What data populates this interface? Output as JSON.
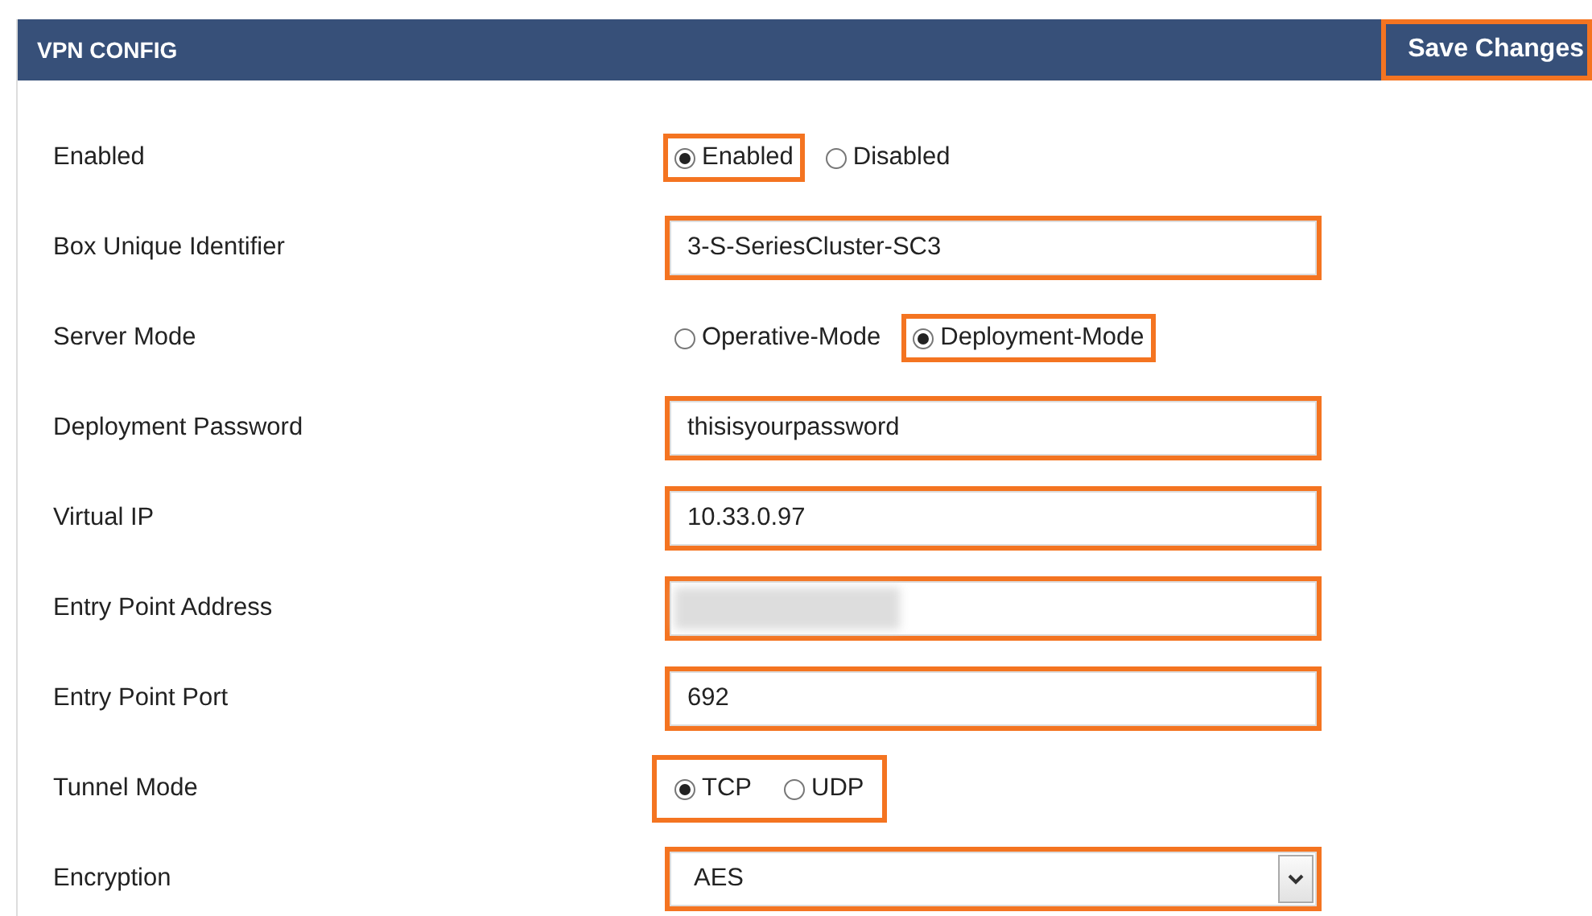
{
  "panel": {
    "title": "VPN CONFIG",
    "save_button": {
      "label": "Save Changes",
      "highlighted": true
    }
  },
  "rows": [
    {
      "label": "Enabled",
      "kind": "radio",
      "highlighted": false,
      "options": [
        {
          "label": "Enabled",
          "selected": true,
          "highlighted": true
        },
        {
          "label": "Disabled",
          "selected": false,
          "highlighted": false
        }
      ]
    },
    {
      "label": "Box Unique Identifier",
      "kind": "text",
      "value": "3-S-SeriesCluster-SC3",
      "highlighted": true
    },
    {
      "label": "Server Mode",
      "kind": "radio",
      "highlighted": false,
      "options": [
        {
          "label": "Operative-Mode",
          "selected": false,
          "highlighted": false
        },
        {
          "label": "Deployment-Mode",
          "selected": true,
          "highlighted": true
        }
      ]
    },
    {
      "label": "Deployment Password",
      "kind": "text",
      "value": "thisisyourpassword",
      "highlighted": true
    },
    {
      "label": "Virtual IP",
      "kind": "text",
      "value": "10.33.0.97",
      "highlighted": true
    },
    {
      "label": "Entry Point Address",
      "kind": "text",
      "redacted": true,
      "highlighted": true
    },
    {
      "label": "Entry Point Port",
      "kind": "text",
      "value": "692",
      "highlighted": true
    },
    {
      "label": "Tunnel Mode",
      "kind": "radio",
      "highlighted": true,
      "options": [
        {
          "label": "TCP",
          "selected": true,
          "highlighted": false
        },
        {
          "label": "UDP",
          "selected": false,
          "highlighted": false
        }
      ]
    },
    {
      "label": "Encryption",
      "kind": "select",
      "value": "AES",
      "highlighted": true
    }
  ]
}
